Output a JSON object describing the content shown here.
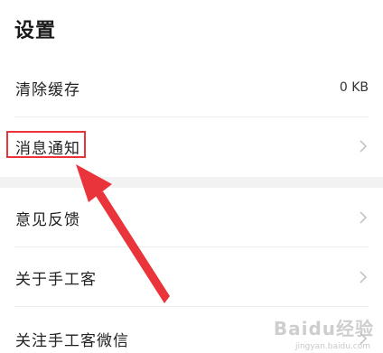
{
  "page": {
    "title": "设置"
  },
  "settings": {
    "clear_cache": {
      "label": "清除缓存",
      "value": "0 KB"
    },
    "notifications": {
      "label": "消息通知"
    },
    "feedback": {
      "label": "意见反馈"
    },
    "about": {
      "label": "关于手工客"
    },
    "follow_wechat": {
      "label": "关注手工客微信"
    }
  },
  "annotation": {
    "highlight_color": "#e8343a",
    "arrow_color": "#e8343a"
  },
  "watermark": {
    "text": "Baidu经验",
    "sub": "jingyan.baidu.com"
  }
}
